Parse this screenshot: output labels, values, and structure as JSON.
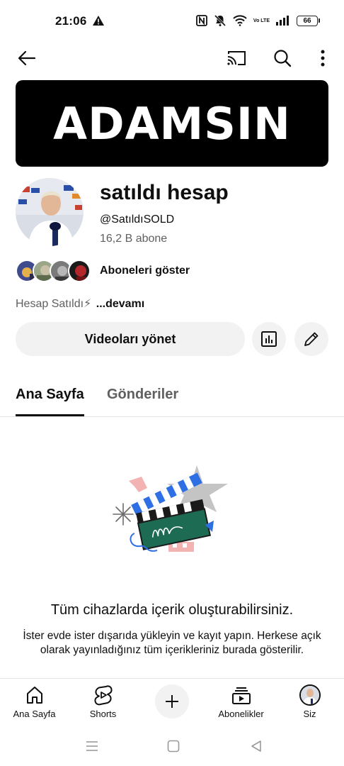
{
  "status_bar": {
    "time": "21:06",
    "battery": "66",
    "volte_label": "Vo LTE"
  },
  "banner": {
    "text": "ADAMSIN"
  },
  "channel": {
    "name": "satıldı hesap",
    "handle": "@SatıldıSOLD",
    "subscribers": "16,2 B abone",
    "show_subscribers": "Aboneleri göster",
    "description": "Hesap Satıldı⚡",
    "more": "...devamı"
  },
  "actions": {
    "manage_videos": "Videoları yönet"
  },
  "tabs": [
    {
      "label": "Ana Sayfa",
      "active": true
    },
    {
      "label": "Gönderiler",
      "active": false
    }
  ],
  "empty_state": {
    "title": "Tüm cihazlarda içerik oluşturabilirsiniz.",
    "body": "İster evde ister dışarıda yükleyin ve kayıt yapın. Herkese açık olarak yayınladığınız tüm içerikleriniz burada gösterilir."
  },
  "bottom_nav": [
    {
      "label": "Ana Sayfa",
      "icon": "home-icon"
    },
    {
      "label": "Shorts",
      "icon": "shorts-icon"
    },
    {
      "label": "",
      "icon": "plus-icon"
    },
    {
      "label": "Abonelikler",
      "icon": "subscriptions-icon"
    },
    {
      "label": "Siz",
      "icon": "profile-avatar"
    }
  ],
  "colors": {
    "text_primary": "#0f0f0f",
    "text_secondary": "#606060",
    "chip_bg": "#f2f2f2",
    "banner_bg": "#000000",
    "illustration_green": "#1e6b53",
    "illustration_blue": "#2f6fe4",
    "illustration_pink": "#f4b3b3"
  }
}
